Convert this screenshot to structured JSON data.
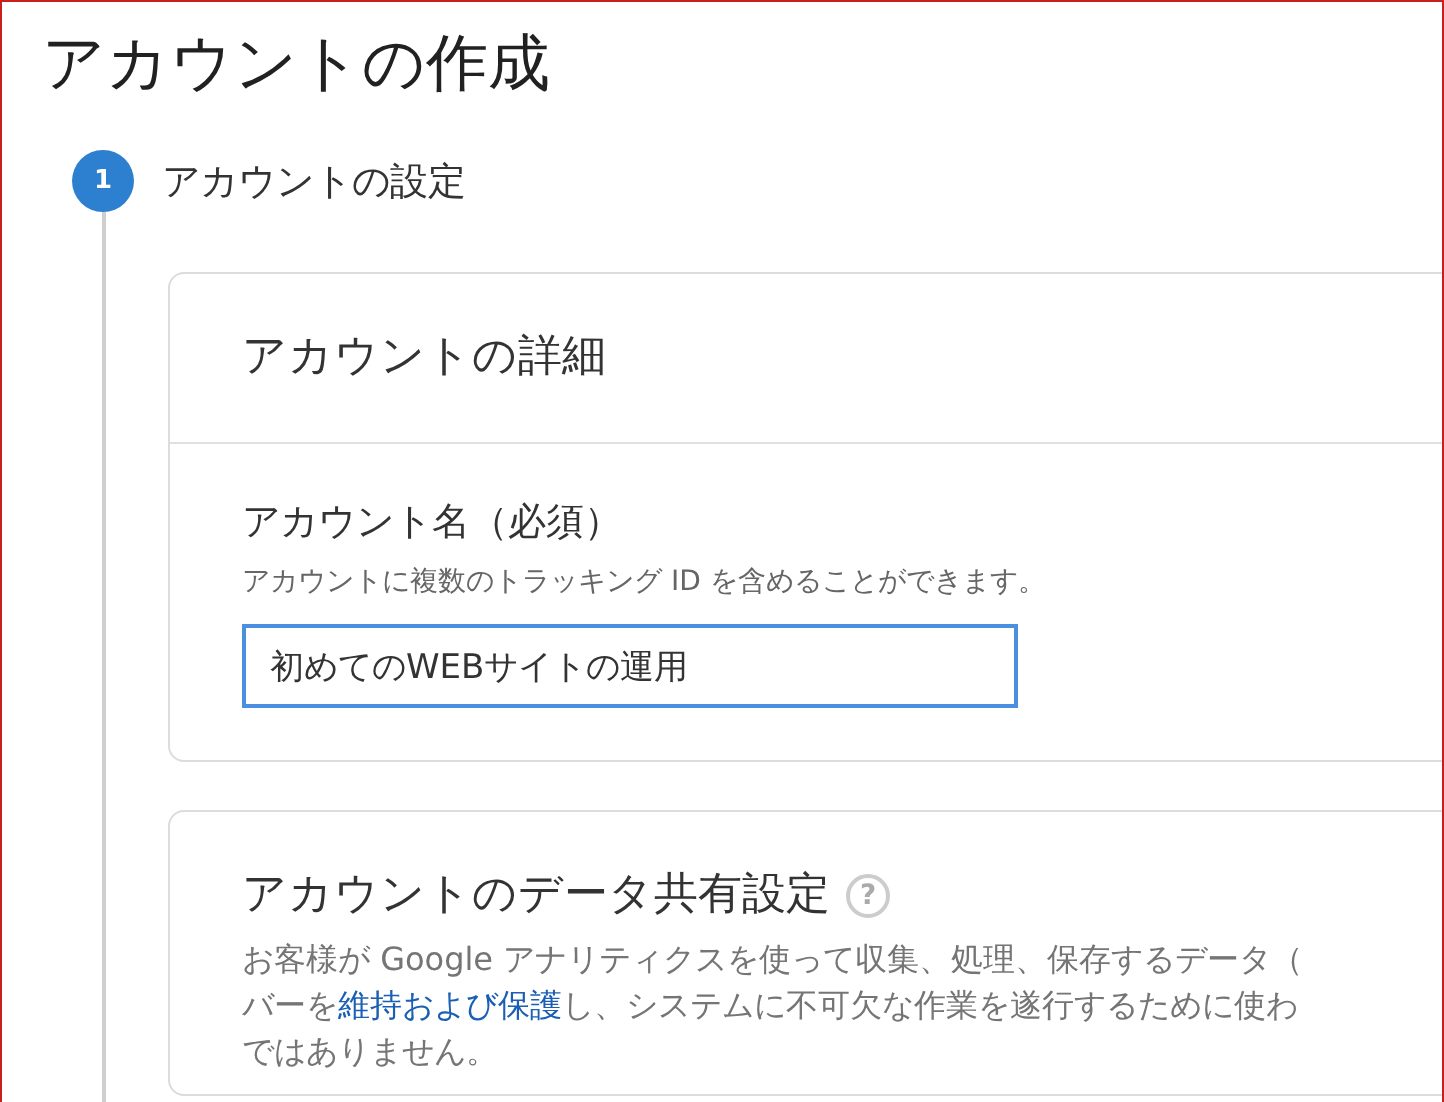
{
  "page_title": "アカウントの作成",
  "step": {
    "number": "1",
    "title": "アカウントの設定",
    "active": true
  },
  "details_card": {
    "title": "アカウントの詳細",
    "account_name": {
      "label": "アカウント名（必須）",
      "hint": "アカウントに複数のトラッキング ID を含めることができます。",
      "value": "初めてのWEBサイトの運用",
      "focused": true
    }
  },
  "sharing_card": {
    "title": "アカウントのデータ共有設定",
    "help_icon": "?",
    "description_lines": [
      [
        {
          "kind": "text",
          "text": "お客様が Google アナリティクスを使って収集、処理、保存するデータ（"
        }
      ],
      [
        {
          "kind": "text",
          "text": "バーを"
        },
        {
          "kind": "link",
          "text": "維持および保護"
        },
        {
          "kind": "text",
          "text": "し、システムに不可欠な作業を遂行するために使わ"
        }
      ],
      [
        {
          "kind": "text",
          "text": "ではありません。"
        }
      ]
    ]
  }
}
